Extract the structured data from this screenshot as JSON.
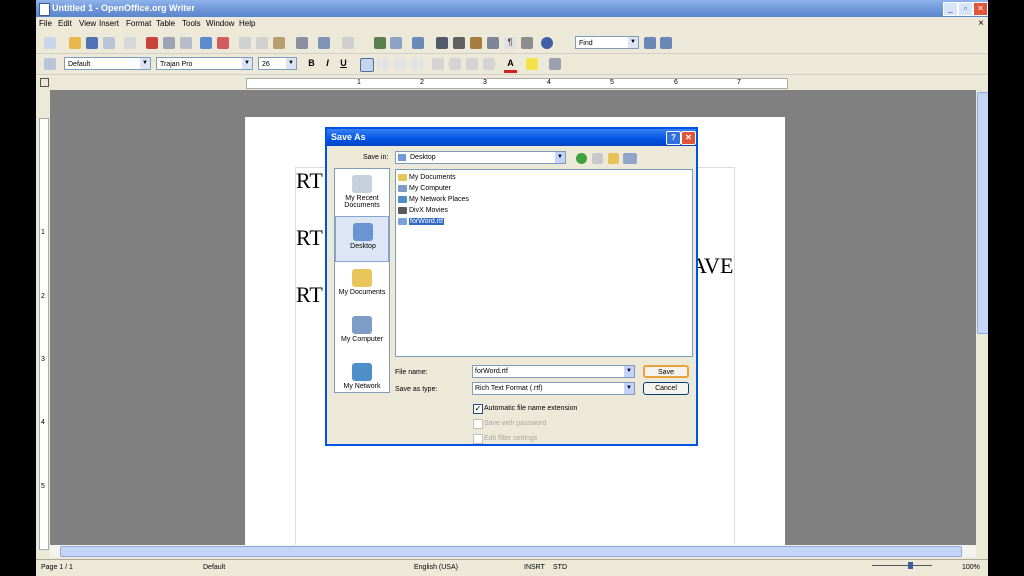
{
  "window": {
    "title": "Untitled 1 - OpenOffice.org Writer",
    "controls": [
      "_",
      "▫",
      "✕"
    ]
  },
  "menubar": {
    "items": [
      "File",
      "Edit",
      "View",
      "Insert",
      "Format",
      "Table",
      "Tools",
      "Window",
      "Help"
    ],
    "close": "×"
  },
  "toolbar": {
    "find_value": "Find"
  },
  "formatting": {
    "style_value": "Default",
    "font_value": "Trajan Pro",
    "size_value": "26",
    "bold": "B",
    "italic": "I",
    "underline": "U",
    "font_color_label": "A"
  },
  "ruler": {
    "numbers": [
      "1",
      "2",
      "3",
      "4",
      "5",
      "6",
      "7"
    ],
    "vnumbers": [
      "1",
      "2",
      "3",
      "4",
      "5"
    ]
  },
  "document": {
    "line1": "RT",
    "line2": "RT",
    "line3": "RT",
    "overflow": "AVE"
  },
  "dialog": {
    "title": "Save As",
    "save_in_label": "Save in:",
    "save_in_value": "Desktop",
    "places": [
      "My Recent Documents",
      "Desktop",
      "My Documents",
      "My Computer",
      "My Network"
    ],
    "files": [
      "My Documents",
      "My Computer",
      "My Network Places",
      "DivX Movies",
      "forWord.rtf"
    ],
    "file_name_label": "File name:",
    "file_name_value": "forWord.rtf",
    "save_type_label": "Save as type:",
    "save_type_value": "Rich Text Format (.rtf)",
    "save_button": "Save",
    "cancel_button": "Cancel",
    "auto_ext_label": "Automatic file name extension",
    "save_password_label": "Save with password",
    "edit_filter_label": "Edit filter settings"
  },
  "status": {
    "page": "Page 1 / 1",
    "style": "Default",
    "language": "English (USA)",
    "insert": "INSRT",
    "selection": "STD",
    "zoom": "100%"
  }
}
